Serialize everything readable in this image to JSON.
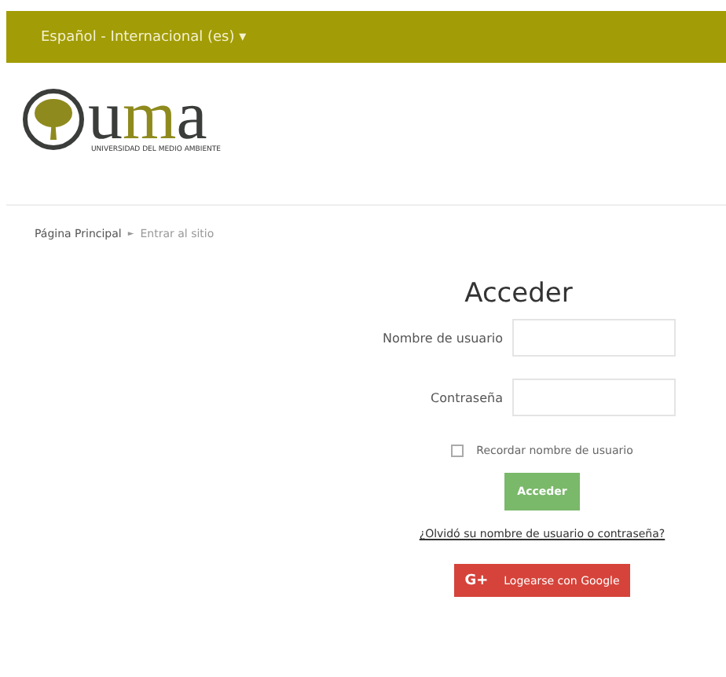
{
  "language_menu": {
    "label": "Español - Internacional (es)",
    "caret": "▾"
  },
  "logo": {
    "wordmark_start": "u",
    "wordmark_mid": "m",
    "wordmark_end": "a",
    "subtitle": "UNIVERSIDAD DEL MEDIO AMBIENTE"
  },
  "breadcrumb": [
    {
      "label": "Página Principal",
      "separator": "►"
    },
    {
      "label": "Entrar al sitio"
    }
  ],
  "login": {
    "title": "Acceder",
    "fields": [
      {
        "label": "Nombre de usuario"
      },
      {
        "label": "Contraseña"
      }
    ],
    "remember": {
      "label": "Recordar nombre de usuario",
      "checked": false
    },
    "submit": "Acceder",
    "forgot_link": "¿Olvidó su nombre de usuario o contraseña?",
    "google_button": {
      "icon": "G+",
      "label": "Logearse con Google"
    }
  }
}
